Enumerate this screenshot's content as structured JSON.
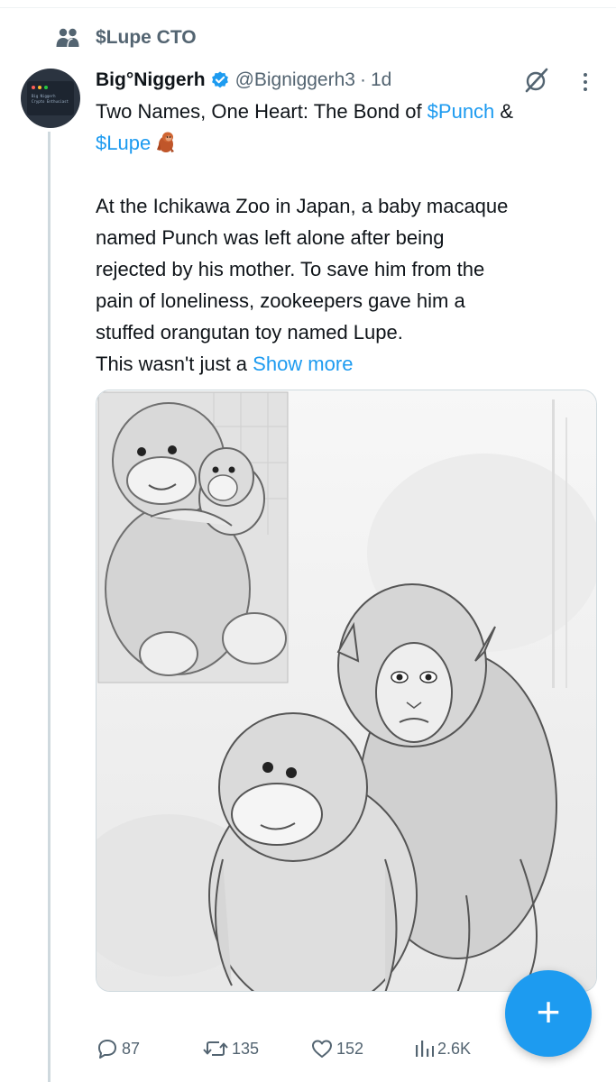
{
  "community": {
    "icon": "people-icon",
    "name": "$Lupe CTO"
  },
  "post": {
    "avatar": {
      "icon": "avatar-terminal",
      "text_line1": "Big Niggerh",
      "text_line2": "Crypto Enthusiast"
    },
    "display_name": "Big°Niggerh",
    "verified_icon": "verified-badge-icon",
    "handle": "@Bigniggerh3",
    "separator": "·",
    "time": "1d",
    "title_prefix": "Two Names, One Heart: The Bond of ",
    "title_link1": "$Punch",
    "title_mid": " &",
    "title_link2": "$Lupe",
    "title_emoji": "orangutan-emoji",
    "body_lines": [
      "At the Ichikawa Zoo in Japan, a baby macaque",
      "named Punch was left alone after being",
      "rejected by his mother. To save him from the",
      "pain of loneliness, zookeepers gave him a",
      "stuffed orangutan toy named Lupe."
    ],
    "truncated_line": "This wasn't just a ",
    "show_more": "Show more",
    "media": {
      "type": "image",
      "description_icon": "illustration-monkeys"
    }
  },
  "actions": {
    "replies": "87",
    "reposts": "135",
    "likes": "152",
    "views": "2.6K"
  },
  "fab": {
    "label": "+",
    "icon": "plus-icon"
  },
  "colors": {
    "accent": "#1d9bf0",
    "text": "#0f1419",
    "secondary": "#536471",
    "border": "#cfd9de"
  }
}
